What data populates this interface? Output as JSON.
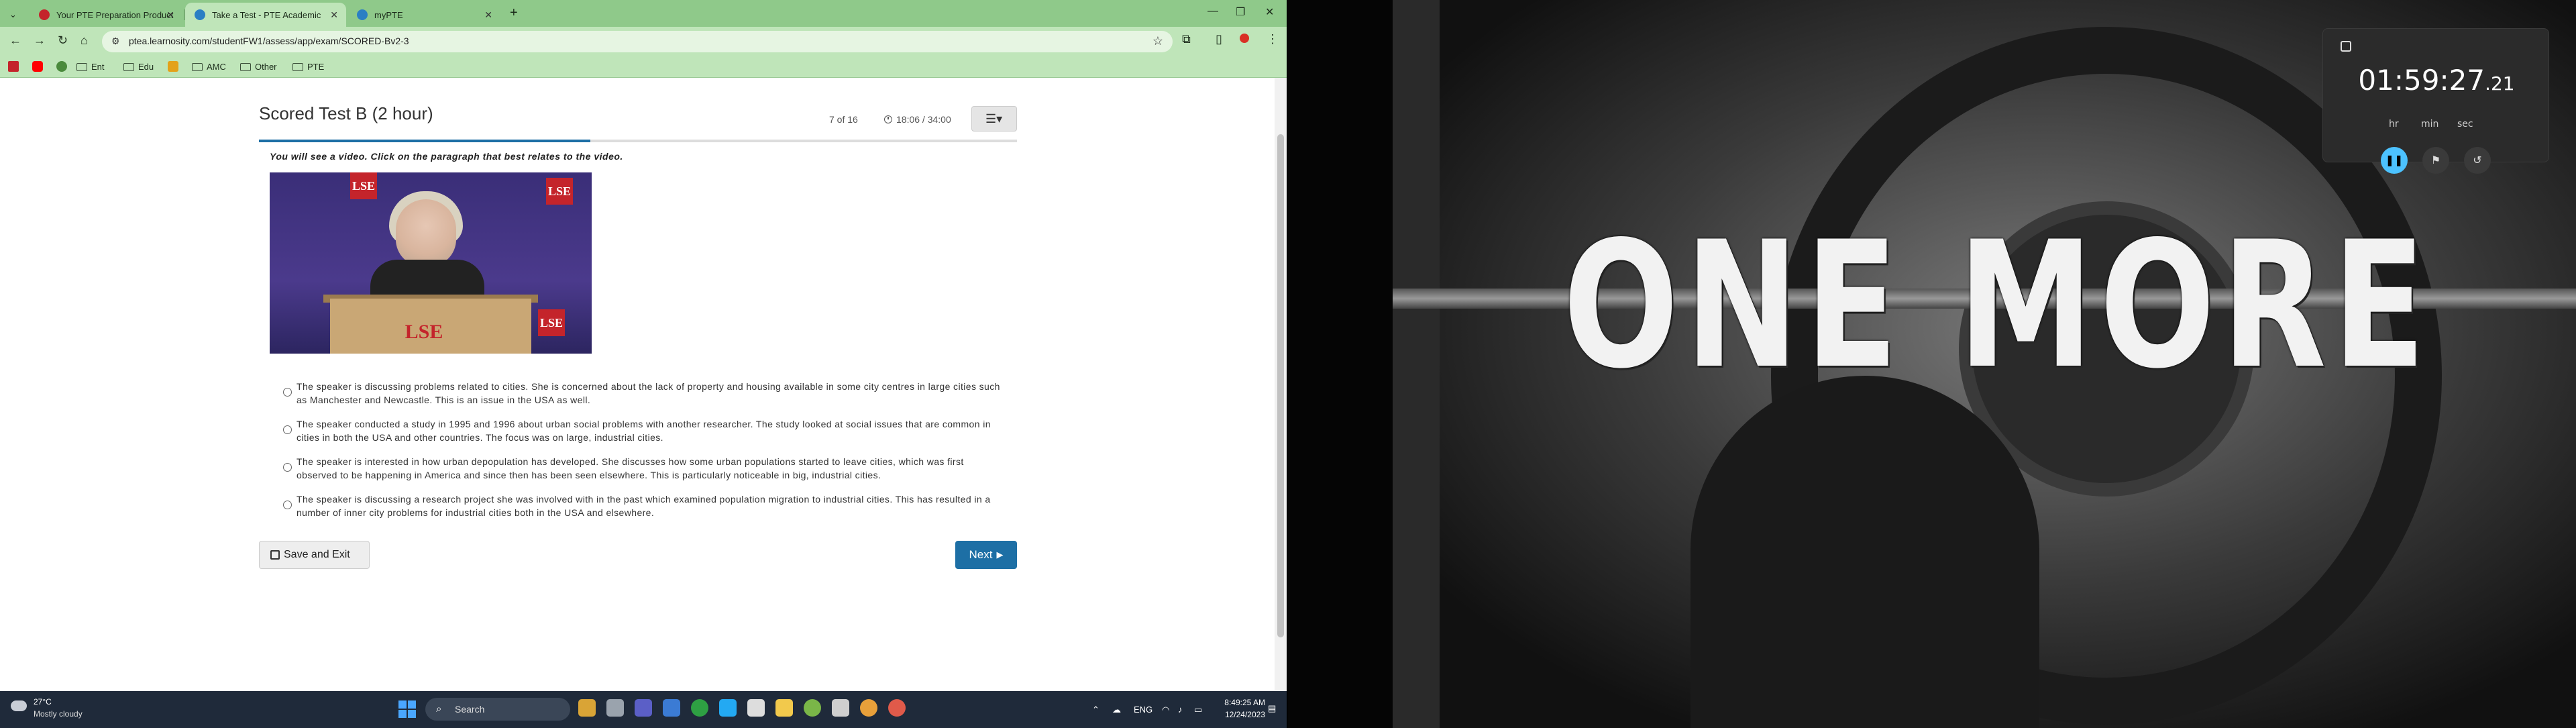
{
  "browser": {
    "tabs": [
      {
        "label": "Your PTE Preparation Product",
        "active": false
      },
      {
        "label": "Take a Test - PTE Academic",
        "active": true
      },
      {
        "label": "myPTE",
        "active": false
      }
    ],
    "new_tab": "+",
    "url": "ptea.learnosity.com/studentFW1/assess/app/exam/SCORED-Bv2-3",
    "bookmarks": [
      "Ent",
      "Edu",
      "AMC",
      "Other",
      "PTE"
    ]
  },
  "exam": {
    "title": "Scored Test B (2 hour)",
    "question_count": "7 of 16",
    "timer": "18:06 / 34:00",
    "progress": 0.4375,
    "instruction": "You will see a video. Click on the paragraph that best relates to the video.",
    "video_logo": "LSE",
    "options": [
      "The speaker is discussing problems related to cities. She is concerned about the lack of property and housing available in some city centres in large cities such as Manchester and Newcastle. This is an issue in the USA as well.",
      "The speaker conducted a study in 1995 and 1996 about urban social problems with another researcher. The study looked at social issues that are common in cities in both the USA and other countries. The focus was on large, industrial cities.",
      "The speaker is interested in how urban depopulation has developed. She discusses how some urban populations started to leave cities, which was first observed to be happening in America and since then has been seen elsewhere. This is particularly noticeable in big, industrial cities.",
      "The speaker is discussing a research project she was involved with in the past which examined population migration to industrial cities. This has resulted in a number of inner city problems for industrial cities both in the USA and elsewhere."
    ],
    "save_exit_label": "Save and Exit",
    "next_label": "Next"
  },
  "wallpaper": {
    "motto": "ONE MORE"
  },
  "stopwatch": {
    "time_main": "01:59:27",
    "time_cs": ".21",
    "units": {
      "hr": "hr",
      "min": "min",
      "sec": "sec"
    }
  },
  "taskbar": {
    "weather_temp": "27°C",
    "weather_desc": "Mostly cloudy",
    "search_placeholder": "Search",
    "language": "ENG",
    "time": "8:49:25 AM",
    "date": "12/24/2023"
  },
  "colors": {
    "browser_theme": "#bfe5b9",
    "accent": "#1d6fa5",
    "stopwatch_play": "#4cc2ff"
  }
}
